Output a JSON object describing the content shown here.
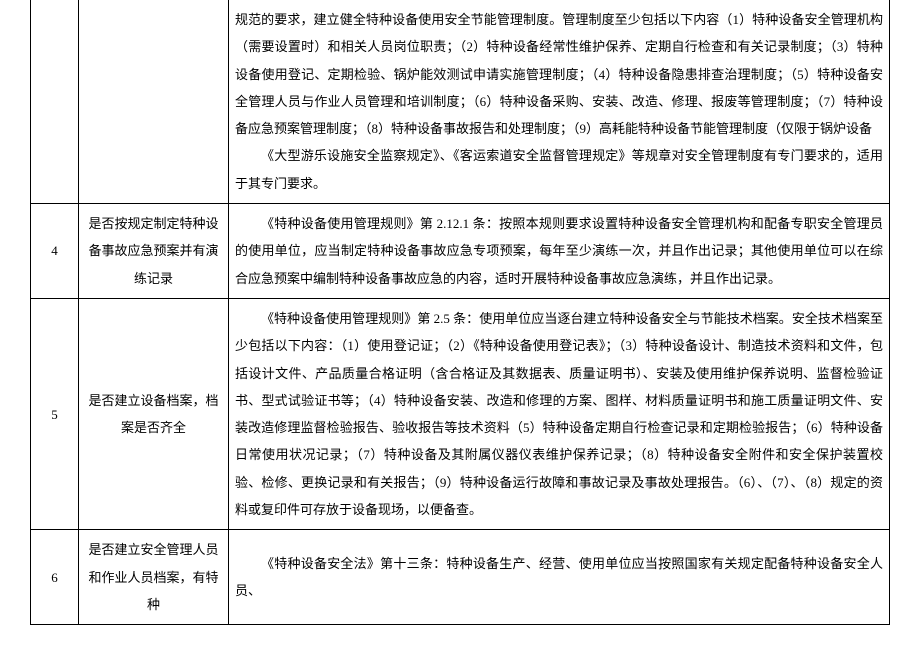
{
  "rows": [
    {
      "num": "",
      "label": "",
      "desc_parts": [
        "规范的要求，建立健全特种设备使用安全节能管理制度。管理制度至少包括以下内容（1）特种设备安全管理机构（需要设置时）和相关人员岗位职责；（2）特种设备经常性维护保养、定期自行检查和有关记录制度；（3）特种设备使用登记、定期检验、锅炉能效测试申请实施管理制度；（4）特种设备隐患排查治理制度；（5）特种设备安全管理人员与作业人员管理和培训制度；（6）特种设备采购、安装、改造、修理、报废等管理制度；（7）特种设备应急预案管理制度；（8）特种设备事故报告和处理制度；（9）高耗能特种设备节能管理制度（仅限于锅炉设备",
        "《大型游乐设施安全监察规定》、《客运索道安全监督管理规定》等规章对安全管理制度有专门要求的，适用于其专门要求。"
      ]
    },
    {
      "num": "4",
      "label": "是否按规定制定特种设备事故应急预案并有演练记录",
      "desc_parts": [
        "《特种设备使用管理规则》第 2.12.1 条：按照本规则要求设置特种设备安全管理机构和配备专职安全管理员的使用单位，应当制定特种设备事故应急专项预案，每年至少演练一次，并且作出记录；其他使用单位可以在综合应急预案中编制特种设备事故应急的内容，适时开展特种设备事故应急演练，并且作出记录。"
      ]
    },
    {
      "num": "5",
      "label": "是否建立设备档案，档案是否齐全",
      "desc_parts": [
        "《特种设备使用管理规则》第 2.5 条：使用单位应当逐台建立特种设备安全与节能技术档案。安全技术档案至少包括以下内容：（1）使用登记证；（2）《特种设备使用登记表》；（3）特种设备设计、制造技术资料和文件，包括设计文件、产品质量合格证明（含合格证及其数据表、质量证明书）、安装及使用维护保养说明、监督检验证书、型式试验证书等；（4）特种设备安装、改造和修理的方案、图样、材料质量证明书和施工质量证明文件、安装改造修理监督检验报告、验收报告等技术资料（5）特种设备定期自行检查记录和定期检验报告；（6）特种设备日常使用状况记录；（7）特种设备及其附属仪器仪表维护保养记录；（8）特种设备安全附件和安全保护装置校验、检修、更换记录和有关报告；（9）特种设备运行故障和事故记录及事故处理报告。（6）、（7）、（8）规定的资料或复印件可存放于设备现场，以便备查。"
      ]
    },
    {
      "num": "6",
      "label": "是否建立安全管理人员和作业人员档案，有特种",
      "desc_parts": [
        "《特种设备安全法》第十三条：特种设备生产、经营、使用单位应当按照国家有关规定配备特种设备安全人员、"
      ]
    }
  ]
}
